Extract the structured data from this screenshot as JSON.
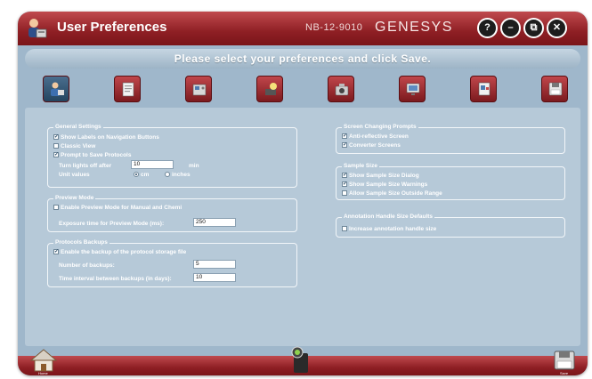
{
  "window": {
    "title": "User Preferences",
    "model": "NB-12-9010",
    "brand": "GENESYS",
    "help_label": "?",
    "minimize_label": "–",
    "restore_label": "⧉",
    "close_label": "✕"
  },
  "instruction": "Please select your preferences and click Save.",
  "nav_icons": [
    "user-settings-icon",
    "document-icon",
    "instrument-icon",
    "lamp-icon",
    "camera-icon",
    "display-icon",
    "report-icon",
    "save-disk-icon"
  ],
  "general_settings": {
    "title": "General Settings",
    "show_labels": {
      "label": "Show Labels on Navigation Buttons",
      "checked": true
    },
    "classic_view": {
      "label": "Classic View",
      "checked": false
    },
    "prompt_save": {
      "label": "Prompt to Save Protocols",
      "checked": true
    },
    "lights_label": "Turn lights off after",
    "lights_value": "10",
    "lights_unit": "min",
    "unit_values_label": "Unit values",
    "unit_cm": "cm",
    "unit_inches": "inches",
    "unit_selected": "cm"
  },
  "preview_mode": {
    "title": "Preview Mode",
    "enable": {
      "label": "Enable Preview Mode for Manual and Chemi",
      "checked": false
    },
    "exposure_label": "Exposure time for Preview Mode (ms):",
    "exposure_value": "250"
  },
  "protocols_backups": {
    "title": "Protocols Backups",
    "enable": {
      "label": "Enable the backup of the protocol storage file",
      "checked": true
    },
    "number_label": "Number of backups:",
    "number_value": "5",
    "interval_label": "Time interval between backups (in days):",
    "interval_value": "10"
  },
  "screen_prompts": {
    "title": "Screen Changing Prompts",
    "anti_reflective": {
      "label": "Anti-reflective Screen",
      "checked": true
    },
    "converter": {
      "label": "Converter Screens",
      "checked": true
    }
  },
  "sample_size": {
    "title": "Sample Size",
    "show_dialog": {
      "label": "Show Sample Size Dialog",
      "checked": true
    },
    "show_warnings": {
      "label": "Show Sample Size Warnings",
      "checked": true
    },
    "allow_outside": {
      "label": "Allow Sample Size Outside Range",
      "checked": false
    }
  },
  "annotation": {
    "title": "Annotation Handle Size Defaults",
    "increase": {
      "label": "Increase annotation handle size",
      "checked": false
    }
  },
  "check_glyph": "✓",
  "footer": {
    "home_label": "Home",
    "save_label": "Save"
  },
  "colors": {
    "accent_red": "#8e1f24",
    "panel_blue": "#b6c9d8",
    "active_nav": "#23445f"
  }
}
